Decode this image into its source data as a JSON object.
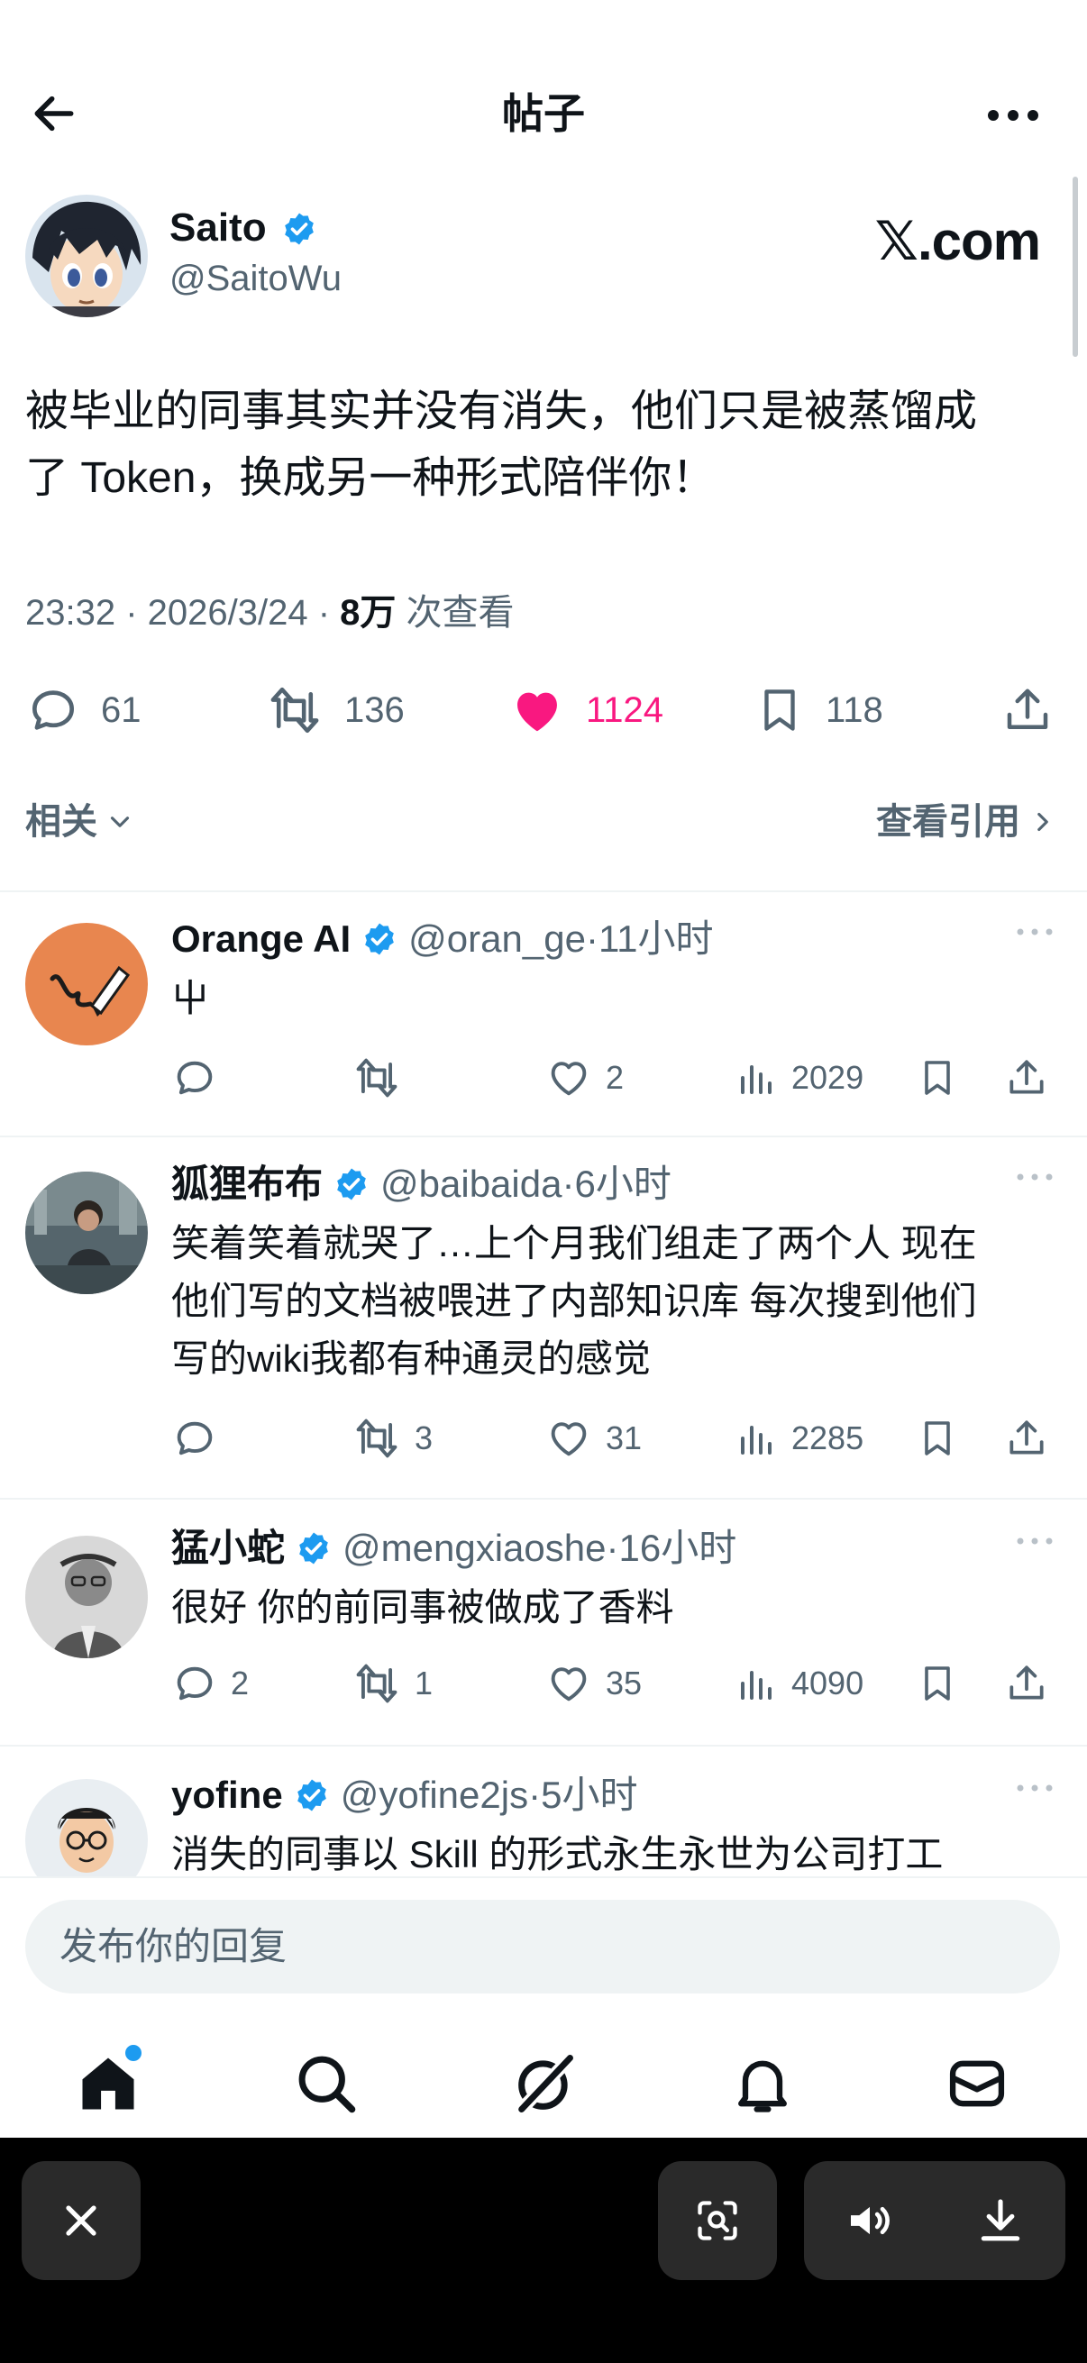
{
  "header": {
    "title": "帖子"
  },
  "post": {
    "author_name": "Saito",
    "author_handle": "@SaitoWu",
    "source_logo": "𝕏.com",
    "text_line1": "被毕业的同事其实并没有消失，他们只是被蒸馏成",
    "text_line2": "了 Token，换成另一种形式陪伴你！",
    "time": "23:32 · 2026/3/24 · ",
    "views": "8万",
    "views_suffix": " 次查看",
    "replies": "61",
    "reposts": "136",
    "likes": "1124",
    "bookmarks": "118",
    "like_color": "#f91880"
  },
  "related": {
    "label": "相关",
    "view_quotes": "查看引用"
  },
  "replies": [
    {
      "name": "Orange AI",
      "handle": "@oran_ge",
      "time": "11小时",
      "text": [
        "屮"
      ],
      "replies": "",
      "reposts": "",
      "likes": "2",
      "views": "2029"
    },
    {
      "name": "狐狸布布",
      "handle": "@baibaida",
      "time": "6小时",
      "text": [
        "笑着笑着就哭了…上个月我们组走了两个人 现在",
        "他们写的文档被喂进了内部知识库 每次搜到他们",
        "写的wiki我都有种通灵的感觉"
      ],
      "replies": "",
      "reposts": "3",
      "likes": "31",
      "views": "2285"
    },
    {
      "name": "猛小蛇",
      "handle": "@mengxiaoshe",
      "time": "16小时",
      "text": [
        "很好 你的前同事被做成了香料"
      ],
      "replies": "2",
      "reposts": "1",
      "likes": "35",
      "views": "4090"
    },
    {
      "name": "yofine",
      "handle": "@yofine2js",
      "time": "5小时",
      "text": [
        "消失的同事以 Skill 的形式永生永世为公司打工"
      ]
    }
  ],
  "composer": {
    "placeholder": "发布你的回复"
  },
  "tabs": [
    "home-icon",
    "search-icon",
    "grok-icon",
    "notifications-icon",
    "messages-icon"
  ],
  "colors": {
    "accent": "#1d9bf0",
    "text": "#0f1419",
    "muted": "#536471",
    "divider": "#eff3f4"
  }
}
